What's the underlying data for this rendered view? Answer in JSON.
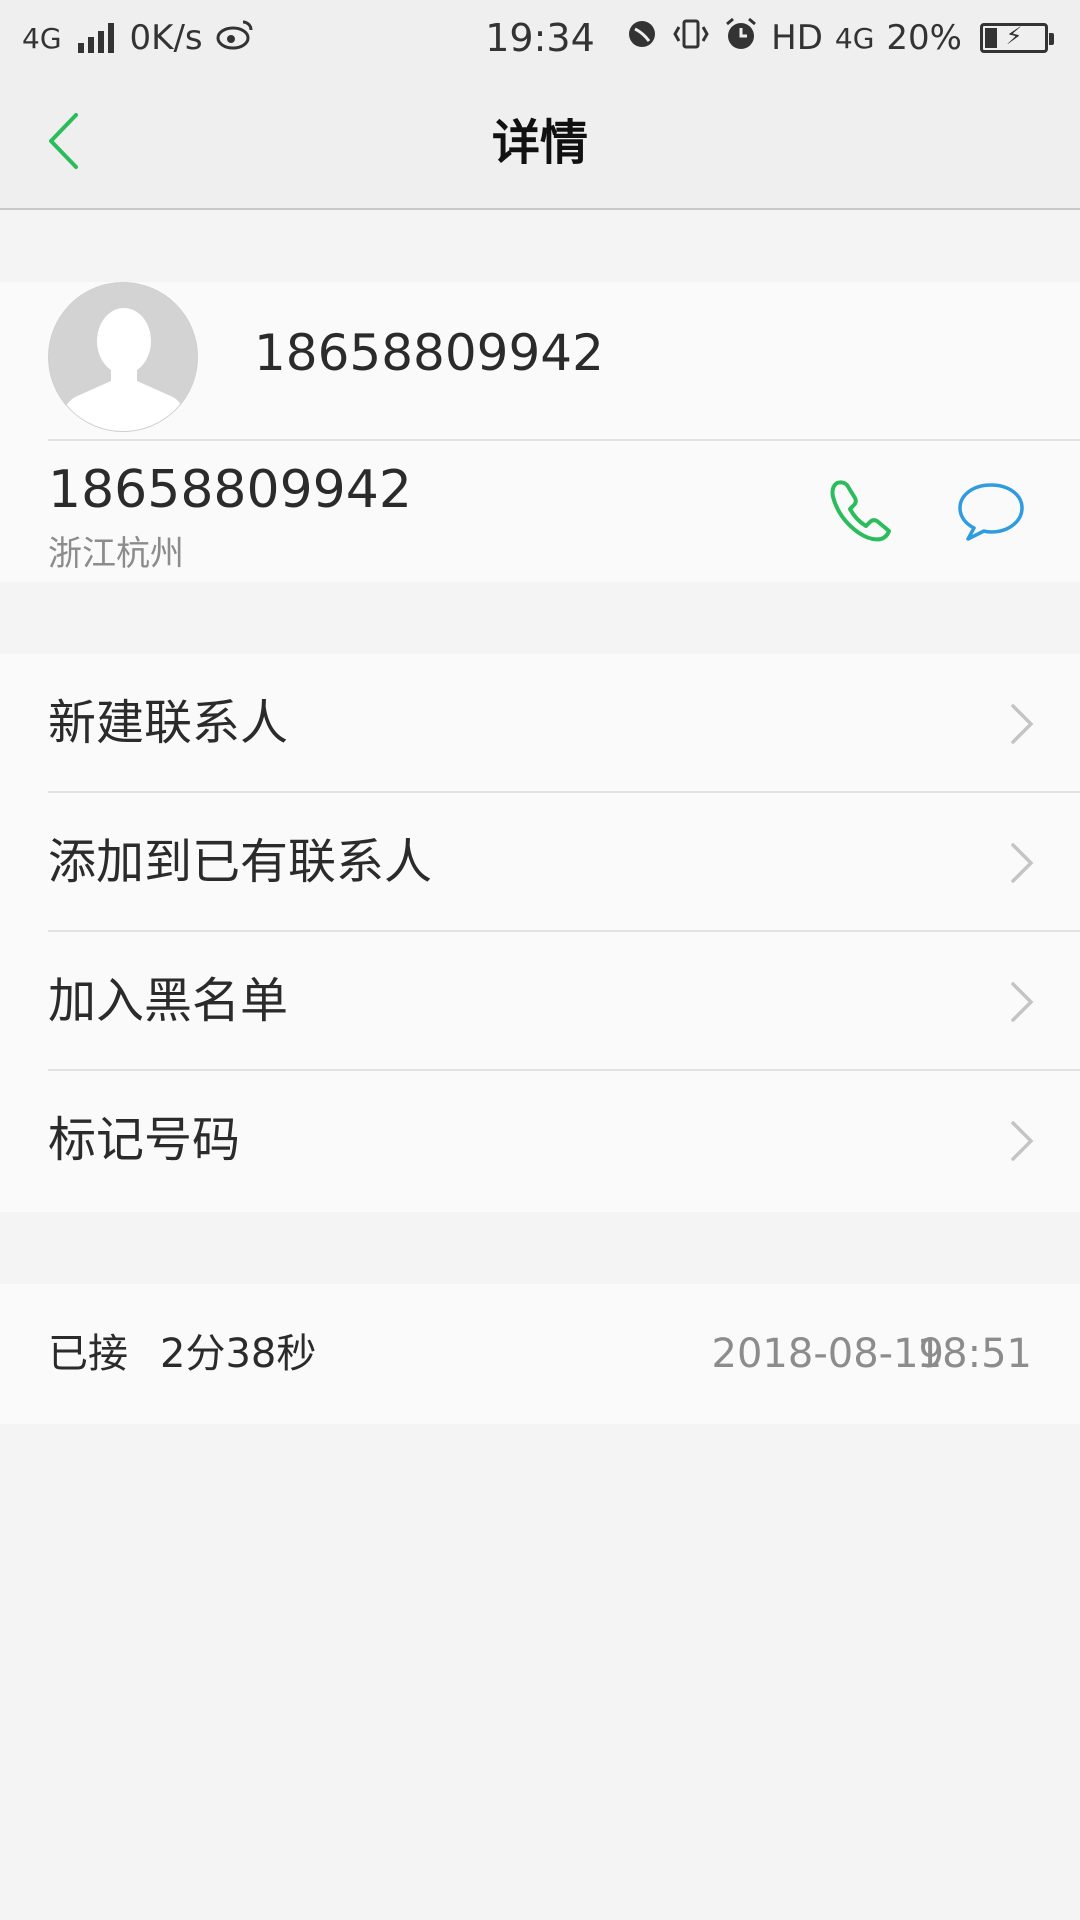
{
  "status_bar": {
    "network": "4G",
    "speed": "0K/s",
    "time": "19:34",
    "hd": "HD",
    "network_right": "4G",
    "battery": "20%",
    "battery_level": 0.2
  },
  "header": {
    "title": "详情"
  },
  "contact": {
    "name": "18658809942",
    "phone": "18658809942",
    "location": "浙江杭州"
  },
  "actions": [
    {
      "label": "新建联系人"
    },
    {
      "label": "添加到已有联系人"
    },
    {
      "label": "加入黑名单"
    },
    {
      "label": "标记号码"
    }
  ],
  "call_log": {
    "status": "已接",
    "duration": "2分38秒",
    "date": "2018-08-19",
    "time": "18:51"
  },
  "colors": {
    "accent_green": "#2bbd5b",
    "accent_blue": "#2f9be0",
    "background": "#f4f4f4",
    "card": "#fafafa"
  }
}
